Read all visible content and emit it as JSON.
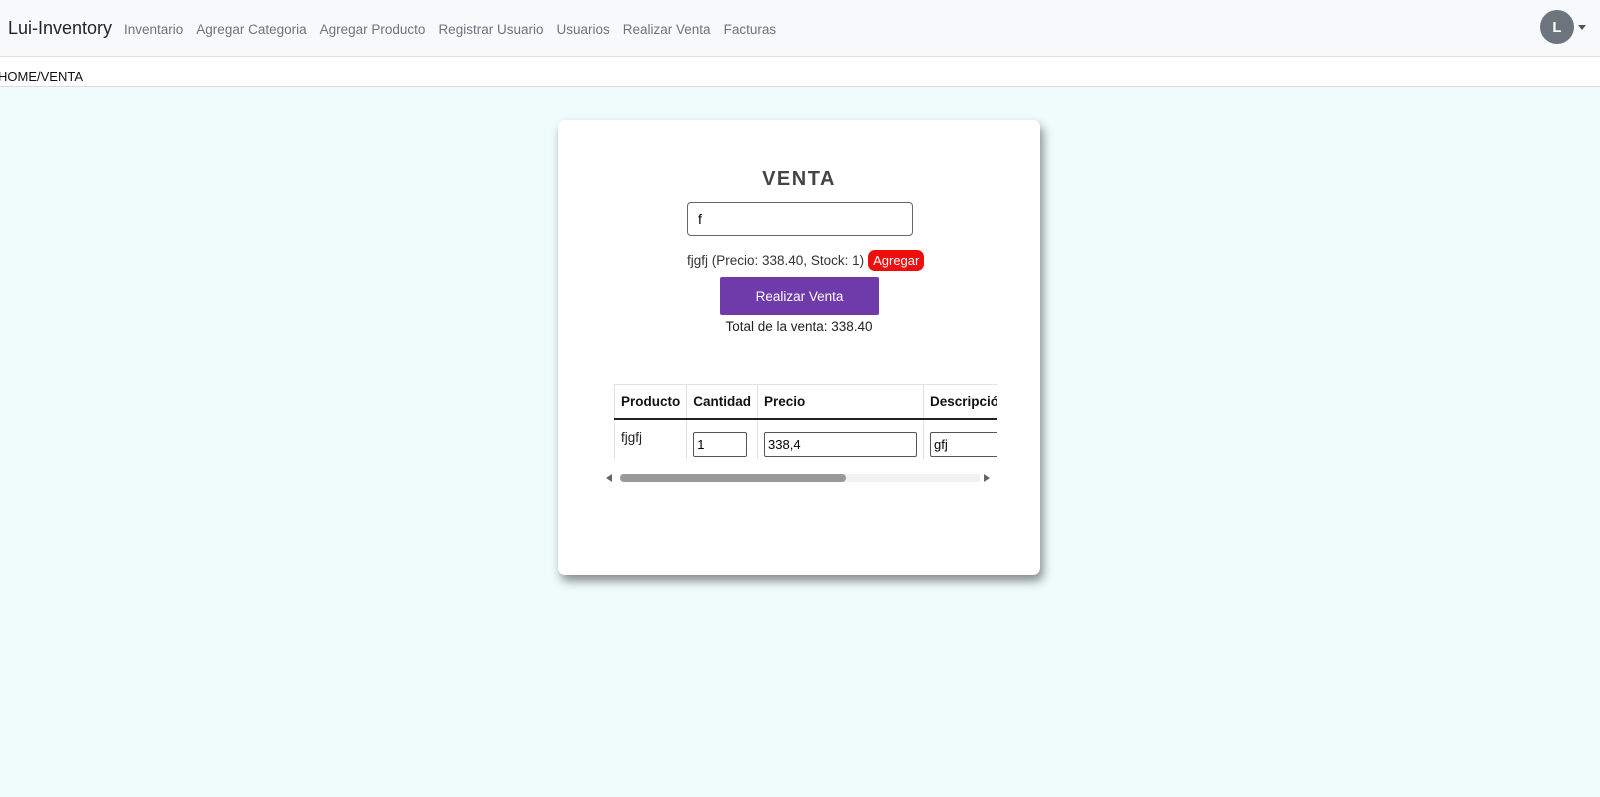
{
  "navbar": {
    "brand": "Lui-Inventory",
    "links": [
      "Inventario",
      "Agregar Categoria",
      "Agregar Producto",
      "Registrar Usuario",
      "Usuarios",
      "Realizar Venta",
      "Facturas"
    ],
    "avatar_letter": "L"
  },
  "breadcrumb": "HOME/VENTA",
  "venta": {
    "title": "VENTA",
    "search_value": "f",
    "result_text": "fjgfj (Precio: 338.40, Stock: 1)",
    "agregar_label": "Agregar",
    "realizar_label": "Realizar Venta",
    "total_text": "Total de la venta: 338.40",
    "table": {
      "headers": [
        "Producto",
        "Cantidad",
        "Precio",
        "Descripció"
      ],
      "rows": [
        {
          "producto": "fjgfj",
          "cantidad": "1",
          "precio": "338,4",
          "descripcion": "gfj"
        }
      ]
    }
  },
  "colors": {
    "page_bg": "#f0fcfc",
    "agregar": "#ee0e0e",
    "realizar": "#6f3bab"
  }
}
